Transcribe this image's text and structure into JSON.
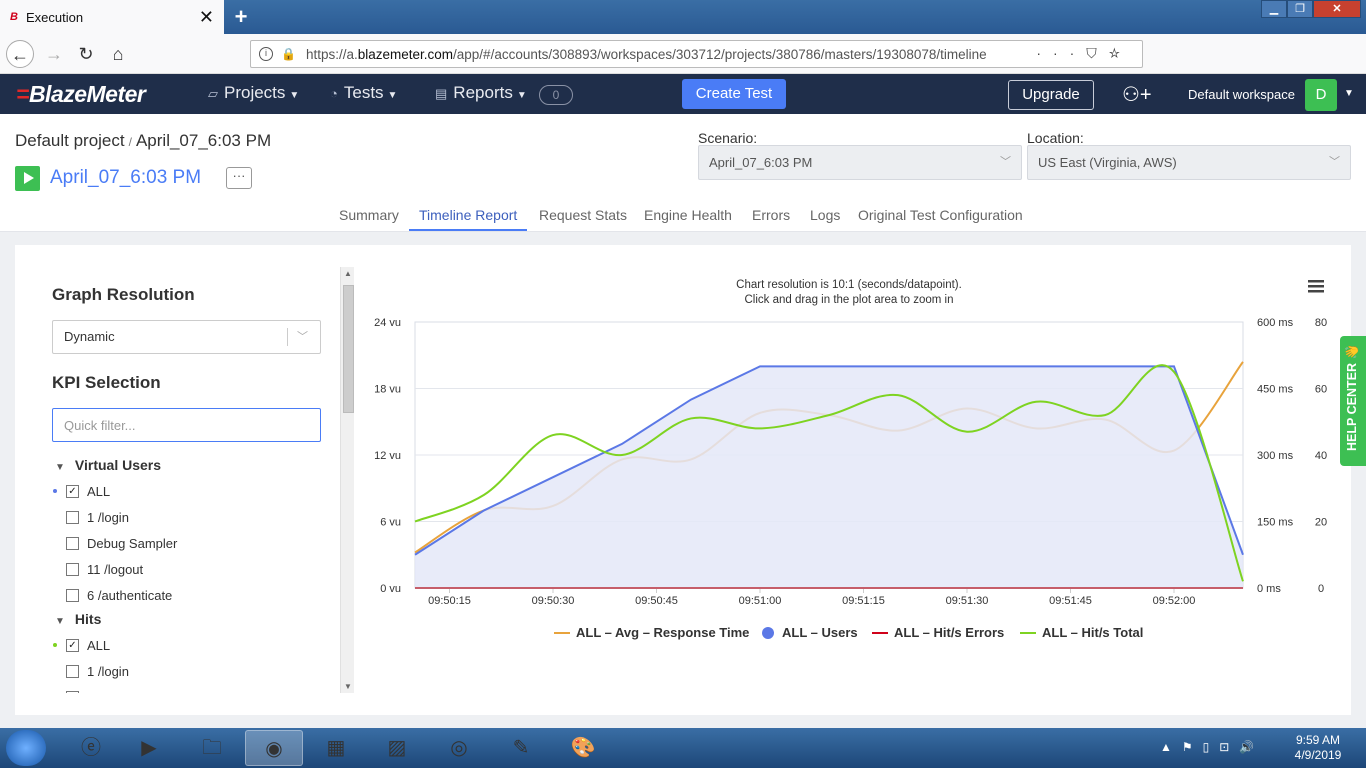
{
  "browser": {
    "tab_title": "Execution",
    "tab_favicon": "B",
    "url_prefix": "https://a.",
    "url_domain": "blazemeter.com",
    "url_path": "/app/#/accounts/308893/workspaces/303712/projects/380786/masters/19308078/timeline"
  },
  "app": {
    "logo": "BlazeMeter",
    "menu": {
      "projects": "Projects",
      "tests": "Tests",
      "reports": "Reports"
    },
    "badge_count": "0",
    "create_test": "Create Test",
    "upgrade": "Upgrade",
    "workspace": "Default workspace",
    "avatar_initial": "D"
  },
  "subheader": {
    "project": "Default project",
    "separator": "/",
    "run_name": "April_07_6:03 PM",
    "test_name": "April_07_6:03 PM",
    "more": "···",
    "scenario_label": "Scenario:",
    "scenario_value": "April_07_6:03 PM",
    "location_label": "Location:",
    "location_value": "US East (Virginia, AWS)",
    "tabs": {
      "summary": "Summary",
      "timeline": "Timeline Report",
      "requests": "Request Stats",
      "engine": "Engine Health",
      "errors": "Errors",
      "logs": "Logs",
      "config": "Original Test Configuration"
    }
  },
  "sidebar": {
    "resolution_title": "Graph Resolution",
    "resolution_value": "Dynamic",
    "kpi_title": "KPI Selection",
    "filter_placeholder": "Quick filter...",
    "groups": {
      "virtual_users": {
        "label": "Virtual Users",
        "items": [
          {
            "label": "ALL",
            "checked": true
          },
          {
            "label": "1 /login",
            "checked": false
          },
          {
            "label": "Debug Sampler",
            "checked": false
          },
          {
            "label": "11 /logout",
            "checked": false
          },
          {
            "label": "6 /authenticate",
            "checked": false
          }
        ]
      },
      "hits": {
        "label": "Hits",
        "items": [
          {
            "label": "ALL",
            "checked": true
          },
          {
            "label": "1 /login",
            "checked": false
          }
        ]
      }
    }
  },
  "help_center": "HELP CENTER 👋",
  "chart_data": {
    "type": "line",
    "title": "Chart resolution is 10:1 (seconds/datapoint).",
    "subtitle": "Click and drag in the plot area to zoom in",
    "x": [
      "09:50:10",
      "09:50:20",
      "09:50:30",
      "09:50:40",
      "09:50:50",
      "09:51:00",
      "09:51:10",
      "09:51:20",
      "09:51:30",
      "09:51:40",
      "09:51:50",
      "09:52:00",
      "09:52:10"
    ],
    "xticks": [
      "09:50:15",
      "09:50:30",
      "09:50:45",
      "09:51:00",
      "09:51:15",
      "09:51:30",
      "09:51:45",
      "09:52:00"
    ],
    "axes": {
      "left": {
        "ticks": [
          "0 vu",
          "6 vu",
          "12 vu",
          "18 vu",
          "24 vu"
        ],
        "ylim": [
          0,
          24
        ],
        "unit": "vu"
      },
      "right1": {
        "ticks": [
          "0 ms",
          "150 ms",
          "300 ms",
          "450 ms",
          "600 ms"
        ],
        "ylim": [
          0,
          600
        ],
        "unit": "ms"
      },
      "right2": {
        "ticks": [
          "0",
          "20",
          "40",
          "60",
          "80"
        ],
        "ylim": [
          0,
          80
        ]
      }
    },
    "series": [
      {
        "name": "ALL - Avg - Response Time",
        "axis": "right1",
        "color": "#e8a33c",
        "values": [
          80,
          175,
          185,
          290,
          290,
          395,
          390,
          355,
          405,
          360,
          380,
          310,
          510
        ]
      },
      {
        "name": "ALL - Users",
        "axis": "left",
        "color": "#5b78e6",
        "area": true,
        "values": [
          3,
          7,
          10,
          13,
          17,
          20,
          20,
          20,
          20,
          20,
          20,
          20,
          3
        ]
      },
      {
        "name": "ALL - Hit/s Errors",
        "axis": "right2",
        "color": "#d0021b",
        "values": [
          0,
          0,
          0,
          0,
          0,
          0,
          0,
          0,
          0,
          0,
          0,
          0,
          0
        ]
      },
      {
        "name": "ALL - Hit/s Total",
        "axis": "right2",
        "color": "#7ed321",
        "values": [
          20,
          28,
          46,
          40,
          51,
          48,
          52,
          58,
          47,
          56,
          52,
          65,
          2
        ]
      }
    ],
    "legend": [
      "ALL – Avg – Response Time",
      "ALL – Users",
      "ALL – Hit/s Errors",
      "ALL – Hit/s Total"
    ],
    "legend_position": "bottom",
    "grid": true
  },
  "taskbar": {
    "time": "9:59 AM",
    "date": "4/9/2019"
  }
}
